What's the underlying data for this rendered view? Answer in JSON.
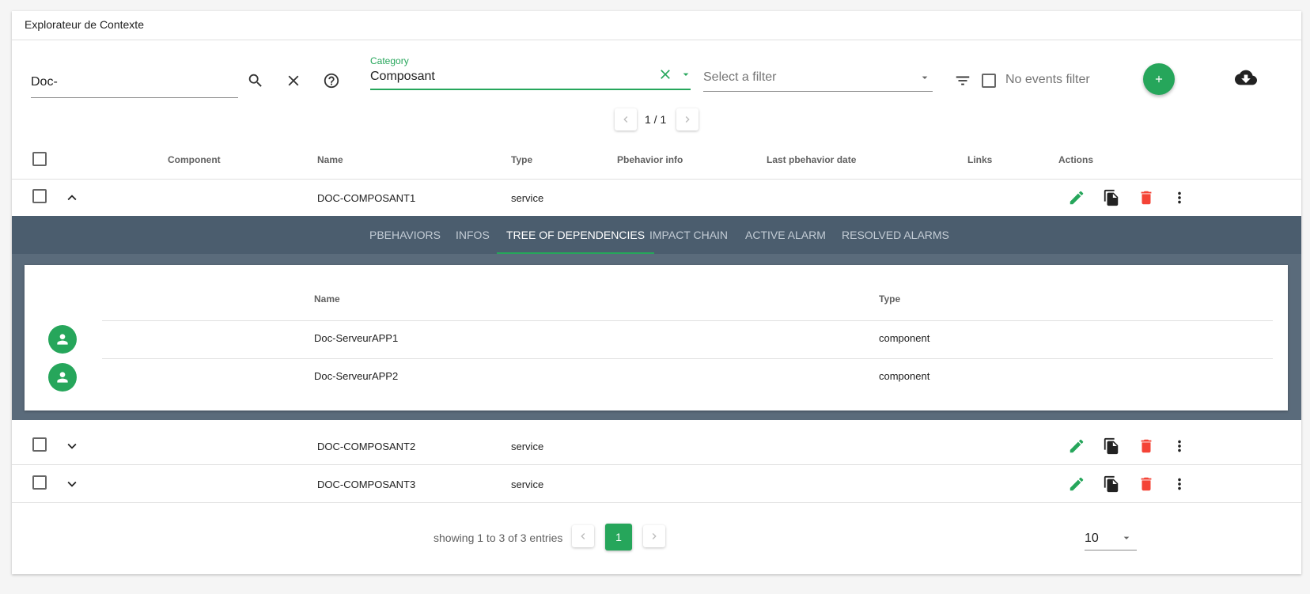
{
  "app": {
    "title": "Explorateur de Contexte"
  },
  "toolbar": {
    "search_value": "Doc-",
    "category_label": "Category",
    "category_value": "Composant",
    "filter_placeholder": "Select a filter",
    "no_events_label": "No events filter",
    "add_label": "+"
  },
  "top_pager": {
    "text": "1 / 1"
  },
  "table": {
    "headers": [
      "Component",
      "Name",
      "Type",
      "Pbehavior info",
      "Last pbehavior date",
      "Links",
      "Actions"
    ],
    "rows": [
      {
        "name": "DOC-COMPOSANT1",
        "type": "service",
        "expanded": true
      },
      {
        "name": "DOC-COMPOSANT2",
        "type": "service",
        "expanded": false
      },
      {
        "name": "DOC-COMPOSANT3",
        "type": "service",
        "expanded": false
      }
    ]
  },
  "expanded": {
    "tabs": [
      "PBEHAVIORS",
      "INFOS",
      "TREE OF DEPENDENCIES",
      "IMPACT CHAIN",
      "ACTIVE ALARM",
      "RESOLVED ALARMS"
    ],
    "active_tab": "TREE OF DEPENDENCIES",
    "dep_headers": [
      "Name",
      "Type"
    ],
    "deps": [
      {
        "name": "Doc-ServeurAPP1",
        "type": "component"
      },
      {
        "name": "Doc-ServeurAPP2",
        "type": "component"
      }
    ]
  },
  "footer": {
    "showing": "showing 1 to 3 of 3 entries",
    "page": "1",
    "per_page": "10"
  },
  "colors": {
    "accent": "#26a65b",
    "danger": "#f44336",
    "panel": "#4b5d6e"
  }
}
